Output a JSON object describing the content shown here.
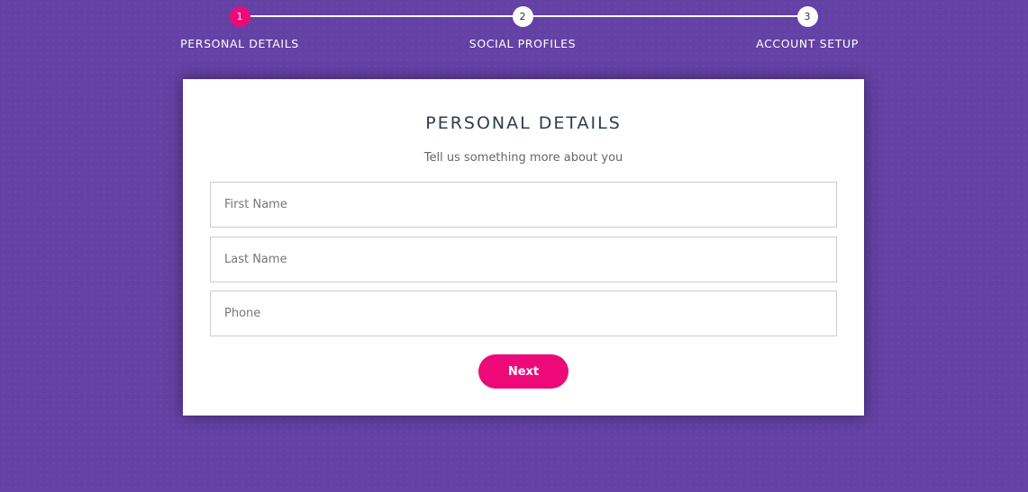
{
  "colors": {
    "background": "#6441a5",
    "accent": "#ee0979",
    "card": "#ffffff",
    "title": "#2c3e50"
  },
  "progress": {
    "active_step": 1,
    "steps": [
      {
        "number": "1",
        "label": "PERSONAL DETAILS"
      },
      {
        "number": "2",
        "label": "SOCIAL PROFILES"
      },
      {
        "number": "3",
        "label": "ACCOUNT SETUP"
      }
    ]
  },
  "form": {
    "title": "PERSONAL DETAILS",
    "subtitle": "Tell us something more about you",
    "fields": [
      {
        "placeholder": "First Name",
        "value": ""
      },
      {
        "placeholder": "Last Name",
        "value": ""
      },
      {
        "placeholder": "Phone",
        "value": ""
      }
    ],
    "next_label": "Next"
  }
}
